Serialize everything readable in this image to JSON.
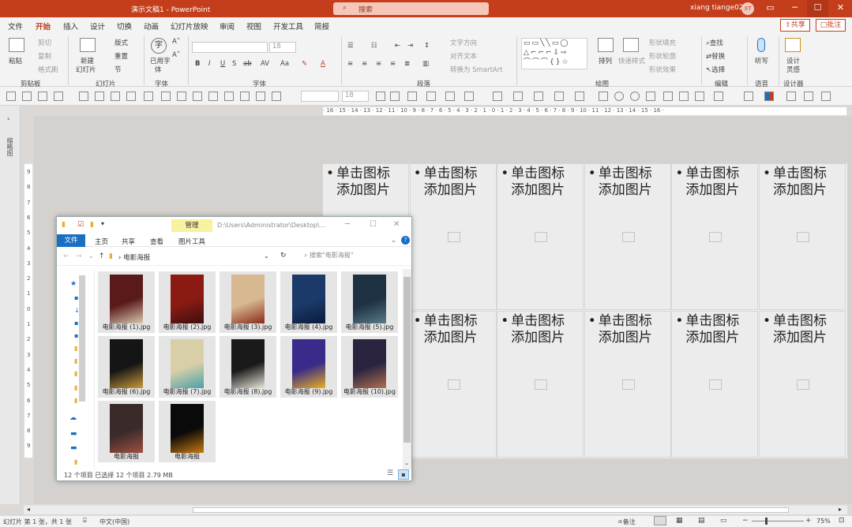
{
  "app": {
    "doc_title": "演示文稿1 - PowerPoint",
    "search_placeholder": "搜索",
    "user_name": "xiang tiange02",
    "user_initials": "XT",
    "accent_color": "#c43e1c"
  },
  "menu": {
    "tabs": [
      "文件",
      "开始",
      "插入",
      "设计",
      "切换",
      "动画",
      "幻灯片放映",
      "审阅",
      "视图",
      "开发工具",
      "简报"
    ],
    "active_tab": "开始",
    "share": "共享",
    "comment": "批注"
  },
  "ribbon": {
    "clipboard": {
      "paste": "粘贴",
      "cut": "剪切",
      "copy": "复制",
      "format_painter": "格式刷",
      "label": "剪贴板"
    },
    "slides": {
      "new_slide": "新建",
      "new_slide2": "幻灯片",
      "layout": "版式",
      "reset": "重置",
      "section": "节",
      "label": "幻灯片"
    },
    "font_group": {
      "used_fonts": "已用字",
      "used_fonts2": "体",
      "label": "字体"
    },
    "font": {
      "size": "18",
      "label": "字体"
    },
    "paragraph": {
      "text_direction": "文字方向",
      "align_text": "对齐文本",
      "smartart": "转换为 SmartArt",
      "label": "段落"
    },
    "drawing": {
      "arrange": "排列",
      "quick_styles": "快速样式",
      "shape_fill": "形状填充",
      "shape_outline": "形状轮廓",
      "shape_effects": "形状效果",
      "label": "绘图"
    },
    "editing": {
      "find": "查找",
      "replace": "替换",
      "select": "选择",
      "label": "编辑"
    },
    "voice": {
      "dictate": "听写",
      "label": "语音"
    },
    "designer": {
      "design_ideas": "设计",
      "design_ideas2": "灵感",
      "label": "设计器"
    }
  },
  "left_panel": {
    "label": "缩略图"
  },
  "ruler": {
    "h_ticks": "· 16 · 15 · 14 · 13 · 12 · 11 · 10 · 9 · 8 · 7 · 6 · 5 · 4 · 3 · 2 · 1 · 0 · 1 · 2 · 3 · 4 · 5 · 6 · 7 · 8 · 9 · 10 · 11 · 12 · 13 · 14 · 15 · 16 ·",
    "v_ticks": [
      "9",
      "8",
      "7",
      "6",
      "5",
      "4",
      "3",
      "2",
      "1",
      "0",
      "1",
      "2",
      "3",
      "4",
      "5",
      "6",
      "7",
      "8",
      "9"
    ]
  },
  "slide": {
    "placeholder_line1": "单击图标",
    "placeholder_line2": "添加图片",
    "rows": 2,
    "cols": 6
  },
  "explorer": {
    "manage_tab": "管理",
    "path_title": "D:\\Users\\Administrator\\Desktop\\...",
    "ribbon_tabs": [
      "文件",
      "主页",
      "共享",
      "查看",
      "图片工具"
    ],
    "folder": "电影海报",
    "search_placeholder": "搜索\"电影海报\"",
    "items": [
      {
        "name": "电影海报 (1).jpg",
        "c1": "#5a1a1a",
        "c2": "#d8c8b0"
      },
      {
        "name": "电影海报 (2).jpg",
        "c1": "#8a1a12",
        "c2": "#3a1010"
      },
      {
        "name": "电影海报 (3).jpg",
        "c1": "#d8b890",
        "c2": "#8a2a1a"
      },
      {
        "name": "电影海报 (4).jpg",
        "c1": "#1b3a6a",
        "c2": "#0b1a3a"
      },
      {
        "name": "电影海报 (5).jpg",
        "c1": "#1d3142",
        "c2": "#5a7a8a"
      },
      {
        "name": "电影海报 (6).jpg",
        "c1": "#151515",
        "c2": "#c89a3a"
      },
      {
        "name": "电影海报 (7).jpg",
        "c1": "#d8cfa8",
        "c2": "#4aa0a8"
      },
      {
        "name": "电影海报 (8).jpg",
        "c1": "#1a1a1a",
        "c2": "#e8e4d8"
      },
      {
        "name": "电影海报 (9).jpg",
        "c1": "#3a2a8a",
        "c2": "#e8b020"
      },
      {
        "name": "电影海报 (10).jpg",
        "c1": "#2a2440",
        "c2": "#b07050"
      },
      {
        "name": "电影海报",
        "c1": "#3a2a2a",
        "c2": "#a05040"
      },
      {
        "name": "电影海报",
        "c1": "#0a0a0a",
        "c2": "#c87a10"
      }
    ],
    "status": "12 个项目    已选择 12 个项目  2.79 MB"
  },
  "statusbar": {
    "slide_info": "幻灯片 第 1 张，共 1 张",
    "language": "中文(中国)",
    "notes": "备注",
    "zoom": "75%"
  }
}
